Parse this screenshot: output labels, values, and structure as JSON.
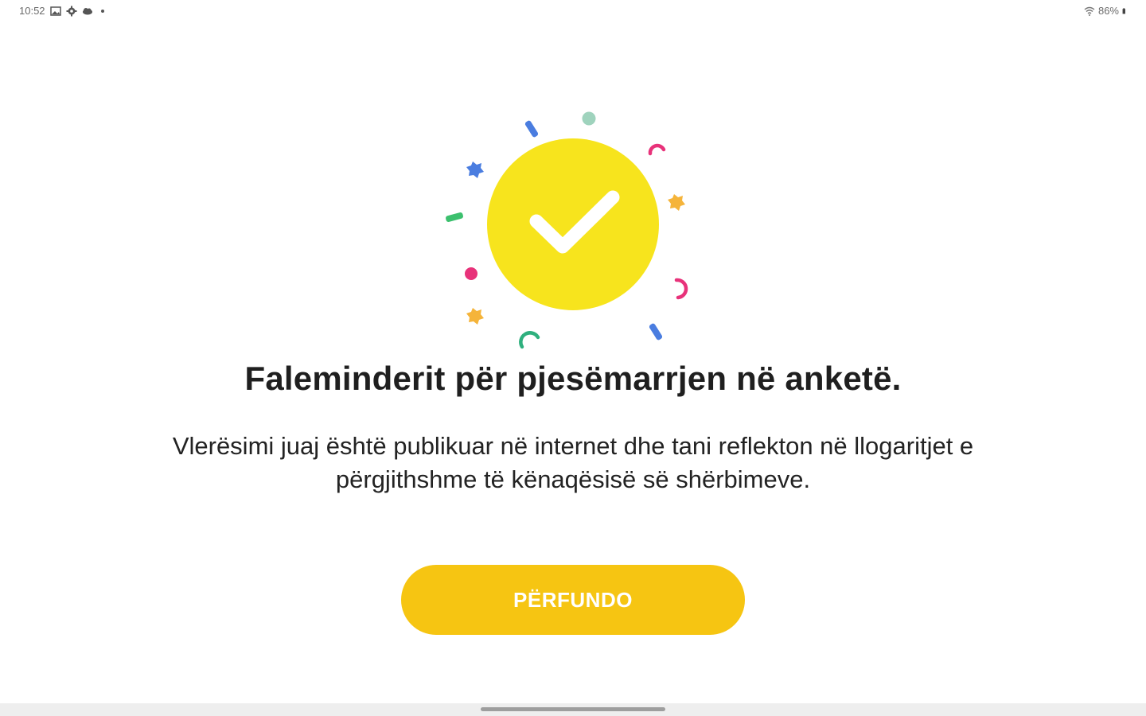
{
  "status_bar": {
    "time": "10:52",
    "battery": "86%",
    "icons": [
      "gallery-icon",
      "settings-icon",
      "cloud-icon",
      "wifi-icon",
      "battery-icon"
    ]
  },
  "hero": {
    "icon": "check-icon",
    "circle_color": "#f7e41d",
    "confetti_colors": [
      "#4a7de0",
      "#9fd3bd",
      "#e8327a",
      "#f5b43a",
      "#3cc06e",
      "#2fb07e"
    ]
  },
  "main": {
    "title": "Faleminderit për pjesëmarrjen në anketë.",
    "description_line1": "Vlerësimi juaj është publikuar në internet dhe tani reflekton në llogaritjet e",
    "description_line2": "përgjithshme të kënaqësisë së shërbimeve."
  },
  "actions": {
    "finish_label": "PËRFUNDO",
    "button_color": "#f6c512"
  }
}
